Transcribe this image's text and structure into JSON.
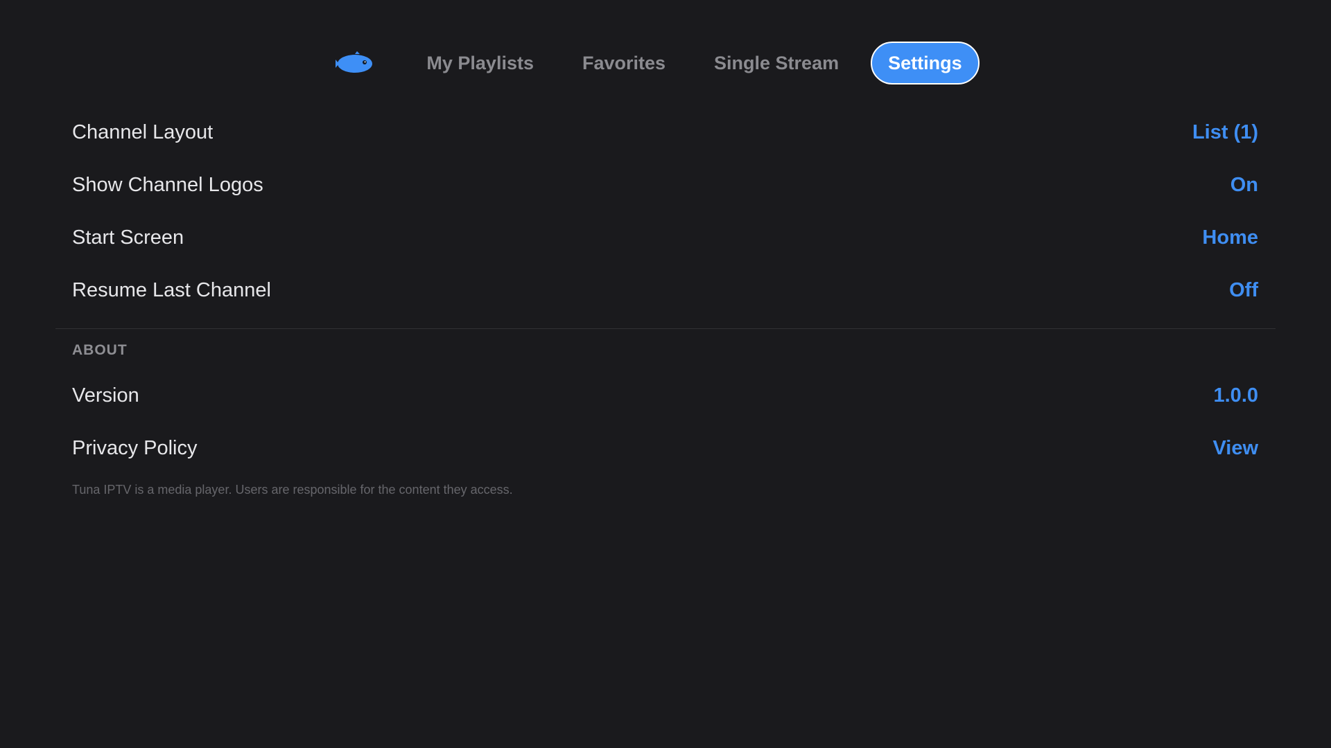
{
  "colors": {
    "background": "#1a1a1d",
    "accent": "#3e8ff6",
    "label_text": "#e7e7ea",
    "inactive_tab_text": "#8b8b90",
    "section_header_text": "#8e8e93",
    "footnote_text": "#66666b"
  },
  "nav": {
    "logo_icon": "fish-icon",
    "tabs": [
      {
        "label": "My Playlists",
        "active": false
      },
      {
        "label": "Favorites",
        "active": false
      },
      {
        "label": "Single Stream",
        "active": false
      },
      {
        "label": "Settings",
        "active": true
      }
    ]
  },
  "settings": {
    "rows": [
      {
        "label": "Channel Layout",
        "value": "List (1)"
      },
      {
        "label": "Show Channel Logos",
        "value": "On"
      },
      {
        "label": "Start Screen",
        "value": "Home"
      },
      {
        "label": "Resume Last Channel",
        "value": "Off"
      }
    ]
  },
  "about": {
    "header": "ABOUT",
    "rows": [
      {
        "label": "Version",
        "value": "1.0.0"
      },
      {
        "label": "Privacy Policy",
        "value": "View"
      }
    ],
    "footnote": "Tuna IPTV is a media player. Users are responsible for the content they access."
  }
}
